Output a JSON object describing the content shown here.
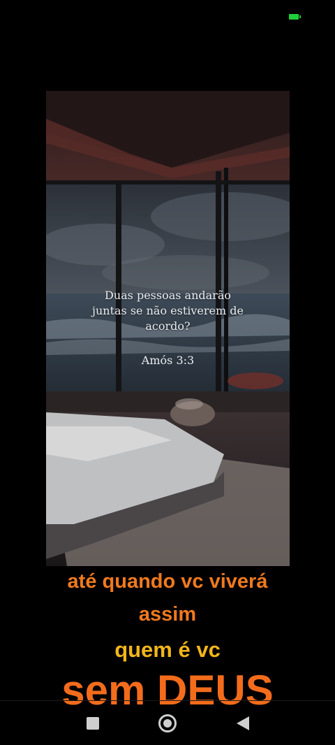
{
  "post": {
    "quote_lines": [
      "Duas pessoas andarão",
      "juntas se não estiverem de",
      "acordo?"
    ],
    "reference": "Amós 3:3"
  },
  "captions": {
    "line1": "até quando vc viverá",
    "line2": "assim",
    "line3": "quem é vc",
    "line4": "sem DEUS"
  },
  "colors": {
    "caption_orange": "#f07a1e",
    "caption_yellow": "#f2b61b",
    "battery_green": "#1fcf3a"
  },
  "icons": {
    "battery": "battery-icon",
    "recents": "square-icon",
    "home": "circle-icon",
    "back": "triangle-back-icon"
  }
}
